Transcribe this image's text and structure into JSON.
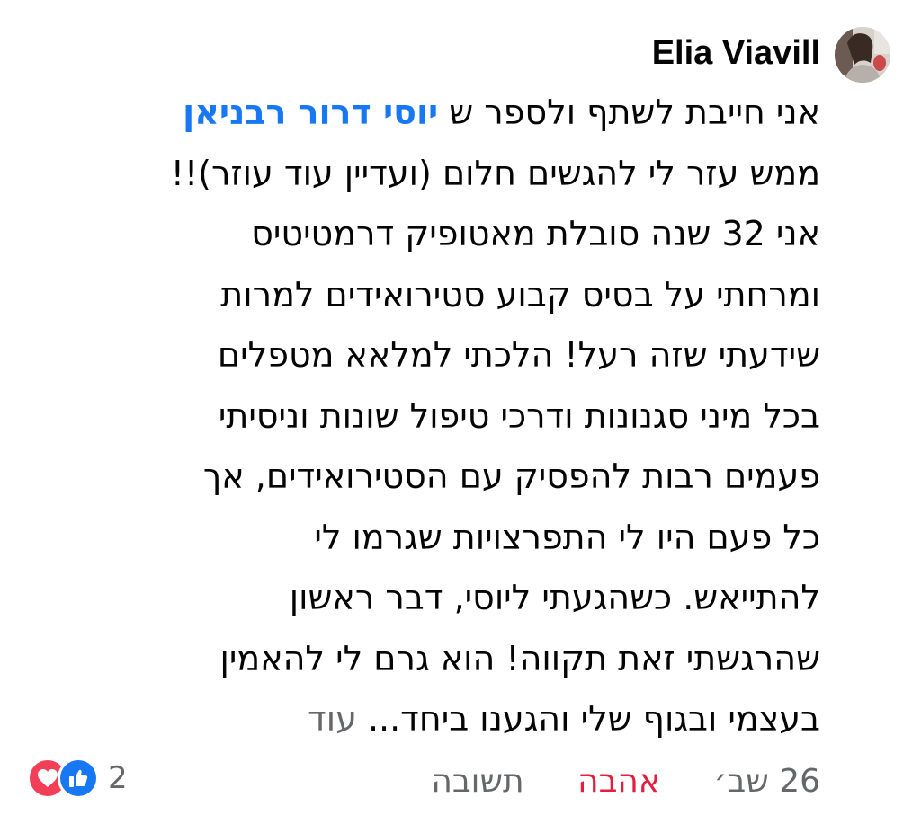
{
  "comment": {
    "author": "Elia Viavill",
    "lines": [
      {
        "prefix": "אני חייבת לשתף ולספר ש ",
        "mention": "יוסי דרור רבניאן"
      },
      {
        "text": "ממש עזר לי להגשים חלום (ועדיין עוד עוזר)!!"
      },
      {
        "text": "אני 32 שנה סובלת מאטופיק דרמטיטיס"
      },
      {
        "text": "ומרחתי על בסיס קבוע סטירואידים למרות"
      },
      {
        "text": "שידעתי שזה רעל! הלכתי למלאא מטפלים"
      },
      {
        "text": "בכל מיני סגנונות ודרכי טיפול שונות וניסיתי"
      },
      {
        "text": "פעמים רבות להפסיק עם הסטירואידים, אך"
      },
      {
        "text": "כל פעם היו לי התפרצויות שגרמו לי"
      },
      {
        "text": "להתייאש. כשהגעתי ליוסי, דבר ראשון"
      },
      {
        "text": "שהרגשתי זאת תקווה! הוא גרם לי להאמין"
      },
      {
        "text": "בעצמי ובגוף שלי והגענו ביחד... ",
        "more": "עוד"
      }
    ],
    "time": "26 שב׳",
    "love_label": "אהבה",
    "reply_label": "תשובה",
    "reaction_count": "2",
    "reaction_icons": [
      "heart-icon",
      "thumbs-up-icon"
    ],
    "colors": {
      "mention": "#1877f2",
      "love_action": "#e41e3f",
      "secondary_text": "#65676b",
      "love_reaction_bg": "#f33e58",
      "like_reaction_bg": "#1877f2"
    }
  }
}
